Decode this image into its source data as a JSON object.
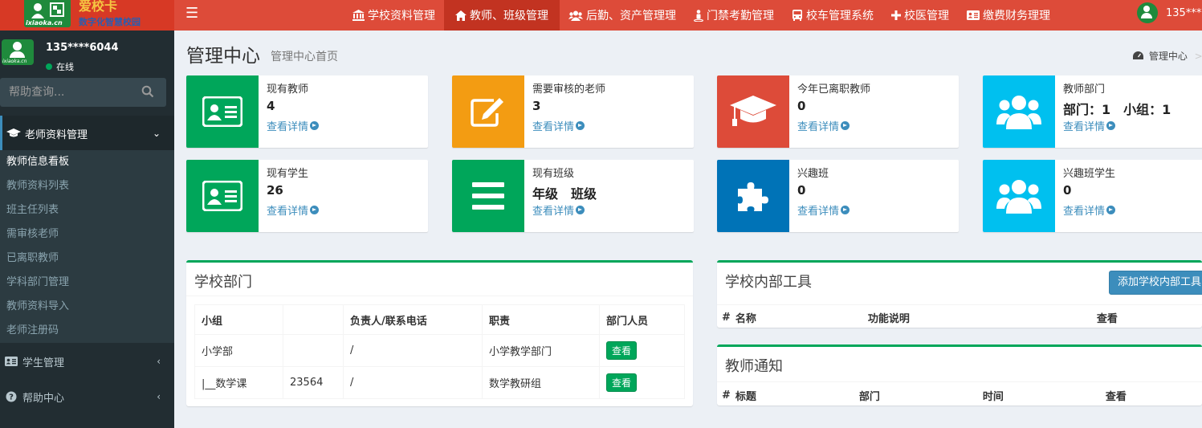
{
  "header": {
    "logo_title": "爱校卡",
    "logo_subtitle": "数字化智慧校园",
    "logo_url": "ixiaoka.cn",
    "menu_icon": "bars-icon",
    "nav": [
      {
        "label": "学校资料管理",
        "icon": "bank-icon"
      },
      {
        "label": "教师、班级管理",
        "icon": "home-icon",
        "active": true
      },
      {
        "label": "后勤、资产管理理",
        "icon": "users-icon"
      },
      {
        "label": "门禁考勤管理",
        "icon": "street-view-icon"
      },
      {
        "label": "校车管理系统",
        "icon": "bus-icon"
      },
      {
        "label": "校医管理",
        "icon": "plus-icon"
      },
      {
        "label": "缴费财务理理",
        "icon": "id-card-icon"
      }
    ],
    "user_label": "135****"
  },
  "sidebar": {
    "user_name": "135****6044",
    "user_status": "在线",
    "avatar_caption": "ixiaoka.cn",
    "search_placeholder": "帮助查询...",
    "menus": [
      {
        "label": "老师资料管理",
        "icon": "graduation-cap-icon",
        "open": true
      },
      {
        "label": "学生管理",
        "icon": "id-card-icon"
      },
      {
        "label": "帮助中心",
        "icon": "question-circle-icon"
      }
    ],
    "submenu": [
      {
        "label": "教师信息看板",
        "active": true
      },
      {
        "label": "教师资料列表"
      },
      {
        "label": "班主任列表"
      },
      {
        "label": "需审核老师"
      },
      {
        "label": "已离职教师"
      },
      {
        "label": "学科部门管理"
      },
      {
        "label": "教师资料导入"
      },
      {
        "label": "老师注册码"
      }
    ]
  },
  "content": {
    "title": "管理中心",
    "subtitle": "管理中心首页",
    "breadcrumb": "管理中心",
    "breadcrumb_sep": ">",
    "info_boxes": [
      {
        "label": "现有教师",
        "number": "4",
        "link": "查看详情",
        "color": "#00a65a",
        "icon": "id-card-icon"
      },
      {
        "label": "需要审核的老师",
        "number": "3",
        "link": "查看详情",
        "color": "#f39c12",
        "icon": "edit-icon"
      },
      {
        "label": "今年已离职教师",
        "number": "0",
        "link": "查看详情",
        "color": "#dd4b39",
        "icon": "graduation-cap-icon"
      },
      {
        "label": "教师部门",
        "number": "部门：1　小组：1",
        "link": "查看详情",
        "color": "#00c0ef",
        "icon": "users-icon"
      },
      {
        "label": "现有学生",
        "number": "26",
        "link": "查看详情",
        "color": "#00a65a",
        "icon": "id-card-icon"
      },
      {
        "label": "现有班级",
        "number": "年级　班级",
        "link": "查看详情",
        "color": "#00a65a",
        "icon": "bars-icon"
      },
      {
        "label": "兴趣班",
        "number": "0",
        "link": "查看详情",
        "color": "#0073b7",
        "icon": "puzzle-icon"
      },
      {
        "label": "兴趣班学生",
        "number": "0",
        "link": "查看详情",
        "color": "#00c0ef",
        "icon": "users-icon"
      }
    ],
    "dept_box": {
      "title": "学校部门",
      "columns": [
        "小组",
        "",
        "负责人/联系电话",
        "职责",
        "部门人员"
      ],
      "rows": [
        {
          "group": "小学部",
          "code": "",
          "contact": "/",
          "duty": "小学教学部门",
          "action": "查看"
        },
        {
          "group": "|__数学课",
          "code": "23564",
          "contact": "/",
          "duty": "数学教研组",
          "action": "查看"
        }
      ]
    },
    "tools_box": {
      "title": "学校内部工具",
      "add_button": "添加学校内部工具",
      "columns": [
        "#",
        "名称",
        "功能说明",
        "查看"
      ]
    },
    "notice_box": {
      "title": "教师通知",
      "columns": [
        "#",
        "标题",
        "部门",
        "时间",
        "查看"
      ]
    }
  }
}
